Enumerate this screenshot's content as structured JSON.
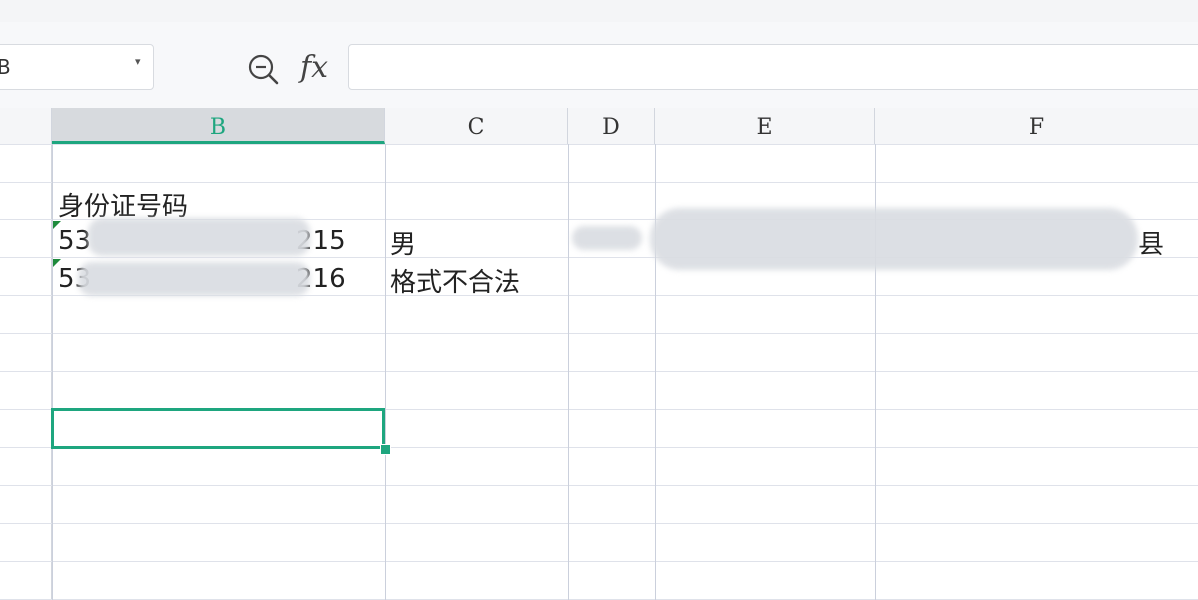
{
  "formula_bar": {
    "name_box_value": "B",
    "caret": "▾",
    "fx_label": "fx",
    "formula_value": ""
  },
  "columns": [
    {
      "label": "B",
      "selected": true
    },
    {
      "label": "C",
      "selected": false
    },
    {
      "label": "D",
      "selected": false
    },
    {
      "label": "E",
      "selected": false
    },
    {
      "label": "F",
      "selected": false
    }
  ],
  "cells": {
    "b_header": "身份证号码",
    "b_row1_start": "53",
    "b_row1_end": "215",
    "c_row1": "男",
    "f_row1_end": "县",
    "b_row2_start": "53",
    "b_row2_end": "216",
    "c_row2": "格式不合法"
  },
  "accent_color": "#1ea67f"
}
